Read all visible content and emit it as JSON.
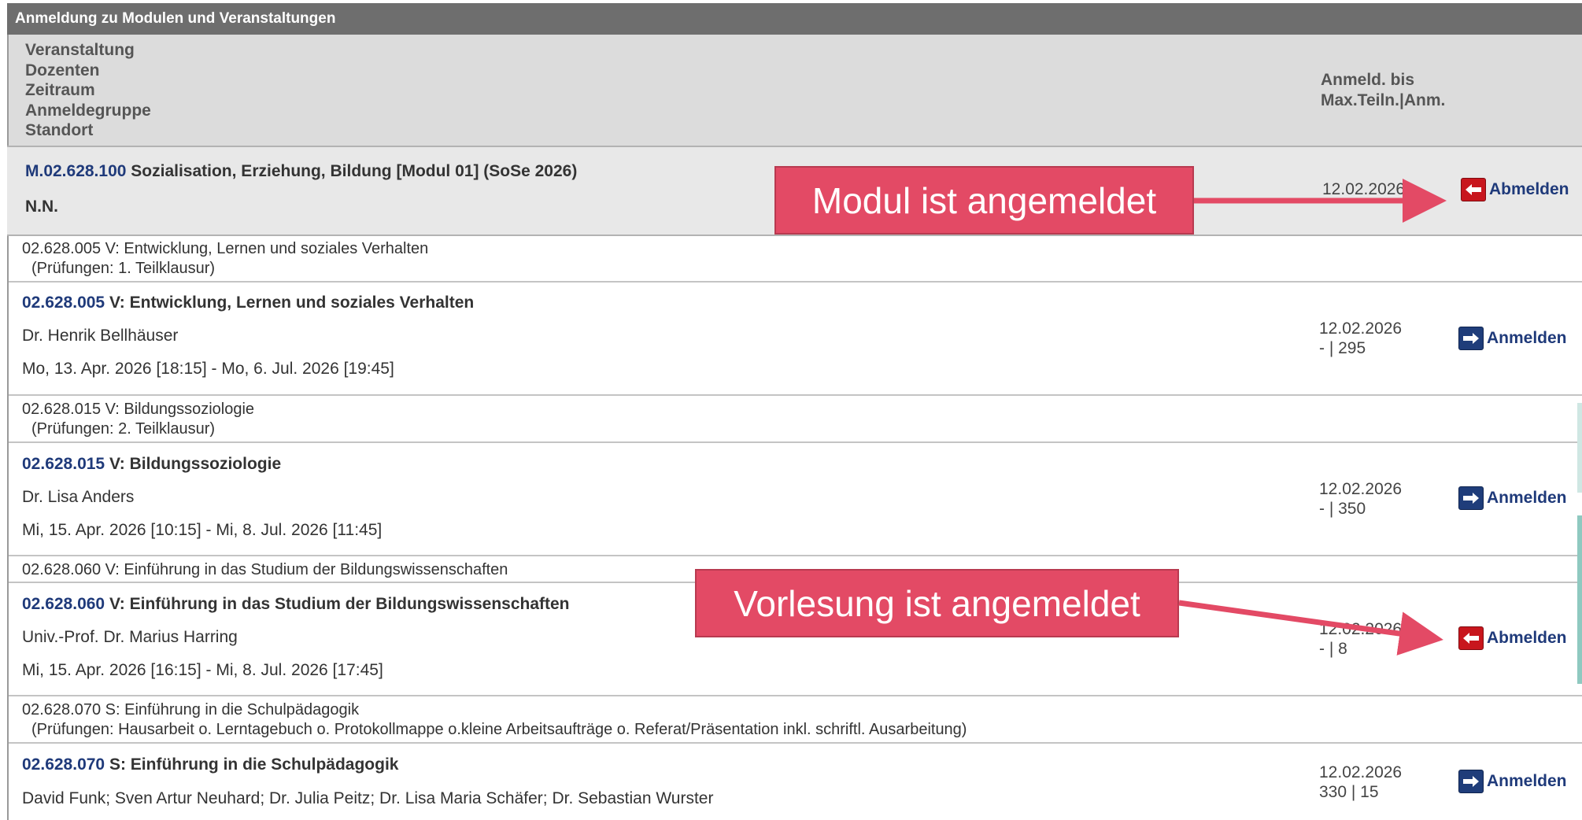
{
  "panel": {
    "title": "Anmeldung zu Modulen und Veranstaltungen"
  },
  "columns": {
    "left": [
      "Veranstaltung",
      "Dozenten",
      "Zeitraum",
      "Anmeldegruppe",
      "Standort"
    ],
    "right": [
      "Anmeld. bis",
      "Max.Teiln.|Anm."
    ]
  },
  "module": {
    "code": "M.02.628.100",
    "title": "Sozialisation, Erziehung, Bildung [Modul 01] (SoSe 2026)",
    "lecturer": "N.N.",
    "deadline": "12.02.2026",
    "action": "Abmelden"
  },
  "groups": [
    {
      "header_line1": "02.628.005 V: Entwicklung, Lernen und soziales Verhalten",
      "header_line2": "(Prüfungen: 1. Teilklausur)",
      "code": "02.628.005",
      "title": "V: Entwicklung, Lernen und soziales Verhalten",
      "lecturer": "Dr. Henrik Bellhäuser",
      "period": "Mo, 13. Apr. 2026 [18:15] - Mo, 6. Jul. 2026 [19:45]",
      "deadline": "12.02.2026",
      "capacity": "- | 295",
      "action": "Anmelden"
    },
    {
      "header_line1": "02.628.015 V: Bildungssoziologie",
      "header_line2": "(Prüfungen: 2. Teilklausur)",
      "code": "02.628.015",
      "title": "V: Bildungssoziologie",
      "lecturer": "Dr. Lisa Anders",
      "period": "Mi, 15. Apr. 2026 [10:15] - Mi, 8. Jul. 2026 [11:45]",
      "deadline": "12.02.2026",
      "capacity": "- | 350",
      "action": "Anmelden"
    },
    {
      "header_line1": "02.628.060 V: Einführung in das Studium der Bildungswissenschaften",
      "code": "02.628.060",
      "title": "V: Einführung in das Studium der Bildungswissenschaften",
      "lecturer": "Univ.-Prof. Dr. Marius Harring",
      "period": "Mi, 15. Apr. 2026 [16:15] - Mi, 8. Jul. 2026 [17:45]",
      "deadline": "12.02.2026",
      "capacity": "- | 8",
      "action": "Abmelden"
    },
    {
      "header_line1": "02.628.070 S: Einführung in die Schulpädagogik",
      "header_line2": "(Prüfungen: Hausarbeit o. Lerntagebuch o. Protokollmappe o.kleine Arbeitsaufträge o. Referat/Präsentation inkl. schriftl. Ausarbeitung)",
      "code": "02.628.070",
      "title": "S: Einführung in die Schulpädagogik",
      "lecturer": "David Funk; Sven Artur Neuhard; Dr. Julia Peitz; Dr. Lisa Maria Schäfer; Dr. Sebastian Wurster",
      "deadline": "12.02.2026",
      "capacity": "330 | 15",
      "action": "Anmelden"
    }
  ],
  "annotations": {
    "module_callout": "Modul ist angemeldet",
    "lecture_callout": "Vorlesung ist angemeldet",
    "color": "#e34a65"
  }
}
